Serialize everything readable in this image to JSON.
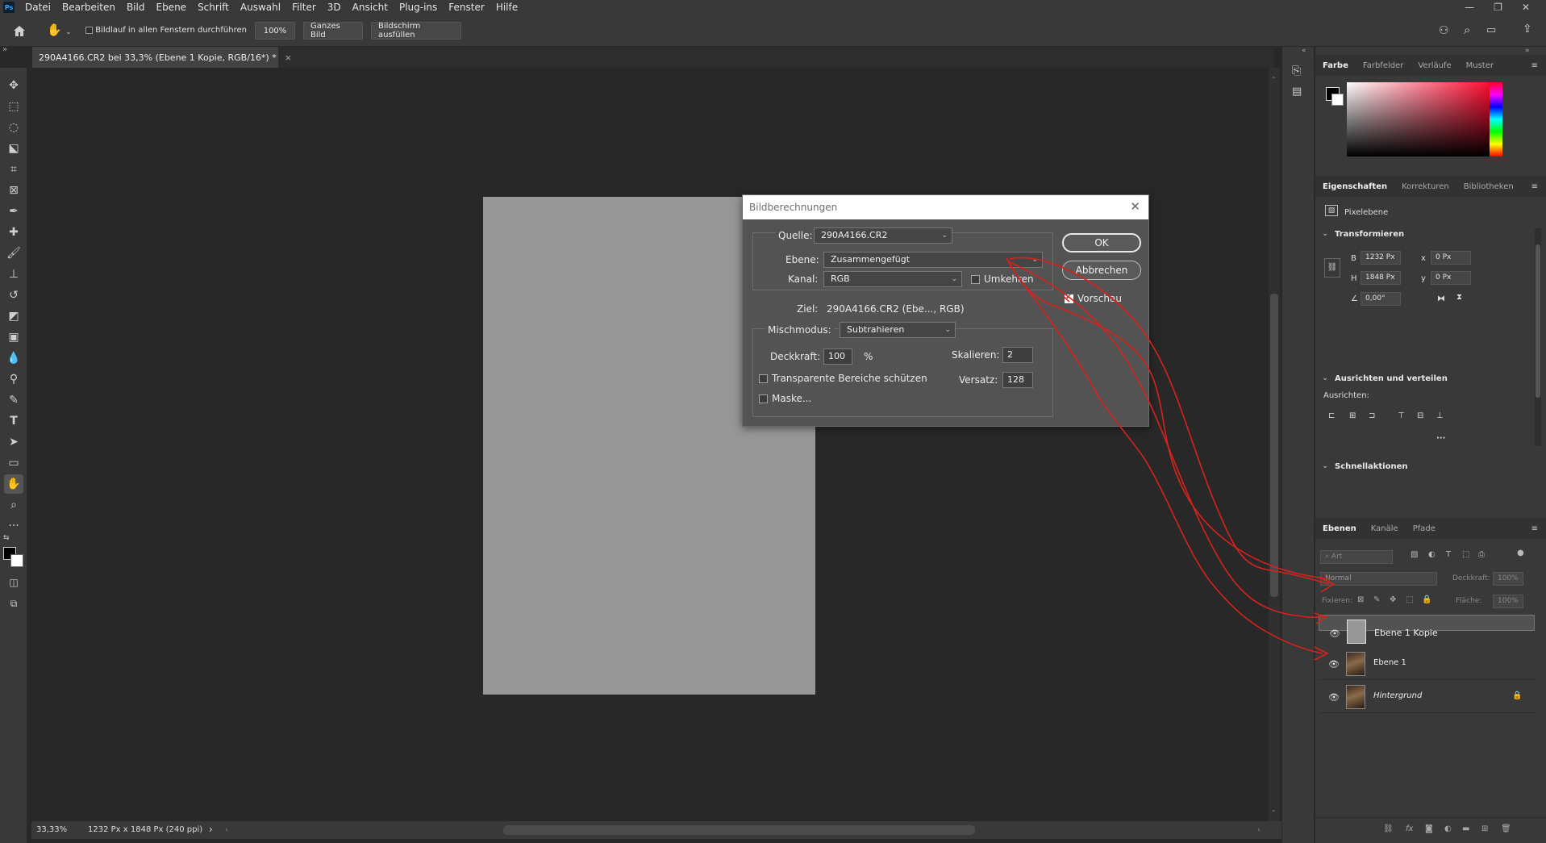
{
  "menubar": {
    "app_icon": "Ps",
    "items": [
      "Datei",
      "Bearbeiten",
      "Bild",
      "Ebene",
      "Schrift",
      "Auswahl",
      "Filter",
      "3D",
      "Ansicht",
      "Plug-ins",
      "Fenster",
      "Hilfe"
    ],
    "window_controls": [
      "—",
      "❐",
      "✕"
    ]
  },
  "optionsbar": {
    "scroll_all_label": "Bildlauf in allen Fenstern durchführen",
    "zoom_btn": "100%",
    "fit_btn": "Ganzes Bild",
    "fill_btn": "Bildschirm ausfüllen"
  },
  "document_tab": {
    "title": "290A4166.CR2 bei 33,3% (Ebene 1 Kopie, RGB/16*) *",
    "close": "×"
  },
  "statusbar": {
    "zoom": "33,33%",
    "info": "1232 Px x 1848 Px (240 ppi)",
    "arrow": "›"
  },
  "color_panel": {
    "tabs": [
      "Farbe",
      "Farbfelder",
      "Verläufe",
      "Muster"
    ],
    "active": "Farbe",
    "colors": {
      "fg": "#000000",
      "bg": "#ffffff",
      "hue": "#ff0026"
    }
  },
  "properties_panel": {
    "tabs": [
      "Eigenschaften",
      "Korrekturen",
      "Bibliotheken"
    ],
    "active": "Eigenschaften",
    "layer_type": "Pixelebene",
    "transform_title": "Transformieren",
    "w_label": "B",
    "w_value": "1232 Px",
    "h_label": "H",
    "h_value": "1848 Px",
    "x_label": "x",
    "x_value": "0 Px",
    "y_label": "y",
    "y_value": "0 Px",
    "angle": "0,00°",
    "align_title": "Ausrichten und verteilen",
    "align_sub": "Ausrichten:",
    "more": "···",
    "quick_title": "Schnellaktionen"
  },
  "layers_panel": {
    "tabs": [
      "Ebenen",
      "Kanäle",
      "Pfade"
    ],
    "active": "Ebenen",
    "filter_placeholder": "Art",
    "blend": "Normal",
    "opacity_label": "Deckkraft:",
    "opacity_value": "100%",
    "lock_label": "Fixieren:",
    "fill_label": "Fläche:",
    "fill_value": "100%",
    "layers": [
      {
        "name": "Ebene 1 Kopie",
        "selected": true
      },
      {
        "name": "Ebene 1",
        "selected": false
      },
      {
        "name": "Hintergrund",
        "selected": false,
        "locked": true
      }
    ]
  },
  "dialog": {
    "title": "Bildberechnungen",
    "close": "✕",
    "quelle_label": "Quelle:",
    "quelle_value": "290A4166.CR2",
    "ebene_label": "Ebene:",
    "ebene_value": "Zusammengefügt",
    "kanal_label": "Kanal:",
    "kanal_value": "RGB",
    "umkehren_label": "Umkehren",
    "ziel_label": "Ziel:",
    "ziel_value": "290A4166.CR2 (Ebe..., RGB)",
    "misch_label": "Mischmodus:",
    "misch_value": "Subtrahieren",
    "deckkraft_label": "Deckkraft:",
    "deckkraft_value": "100",
    "percent": "%",
    "skalieren_label": "Skalieren:",
    "skalieren_value": "2",
    "versatz_label": "Versatz:",
    "versatz_value": "128",
    "transparent_label": "Transparente Bereiche schützen",
    "maske_label": "Maske...",
    "ok_label": "OK",
    "cancel_label": "Abbrechen",
    "preview_label": "Vorschau",
    "preview_checked": true
  },
  "annotation_color": "#d9221c"
}
